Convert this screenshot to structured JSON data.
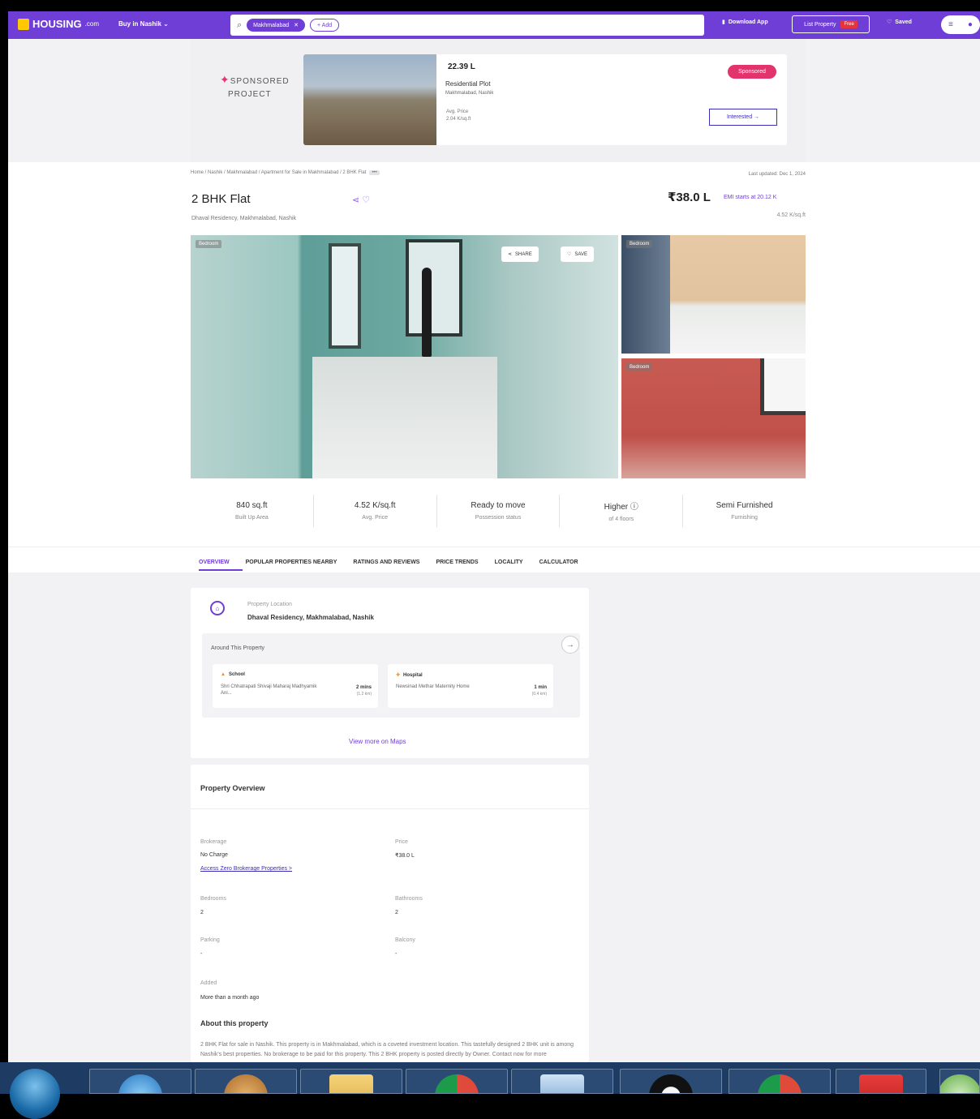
{
  "header": {
    "logo": "HOUSING",
    "logo_suffix": ".com",
    "buy_in": "Buy in Nashik",
    "search_chip": "Makhmalabad",
    "add_chip": "+ Add",
    "download_app": "Download App",
    "list_property": "List Property",
    "free_badge": "Free",
    "saved": "Saved"
  },
  "sponsored": {
    "label_line1": "SPONSORED",
    "label_line2": "PROJECT",
    "price": "22.39 L",
    "type": "Residential Plot",
    "location": "Makhmalabad, Nashik",
    "avg_label": "Avg. Price",
    "avg_value": "2.04 K/sq.ft",
    "badge": "Sponsored",
    "interested": "Interested →"
  },
  "breadcrumb": "Home / Nashik / Makhmalabad / Apartment for Sale in Makhmalabad / 2 BHK Flat",
  "breadcrumb_more": "•••",
  "last_updated": "Last updated: Dec 1, 2024",
  "listing": {
    "title": "2 BHK Flat",
    "subtitle": "Dhaval Residency, Makhmalabad, Nashik",
    "price": "₹38.0 L",
    "emi": "EMI starts at 20.12 K",
    "per_sqft": "4.52 K/sq.ft"
  },
  "gallery": {
    "tag_main": "Bedroom",
    "tag_side1": "Bedroom",
    "tag_side2": "Bedroom",
    "share": "SHARE",
    "save": "SAVE"
  },
  "stats": [
    {
      "value": "840 sq.ft",
      "label": "Built Up Area"
    },
    {
      "value": "4.52 K/sq.ft",
      "label": "Avg. Price"
    },
    {
      "value": "Ready to move",
      "label": "Possession status"
    },
    {
      "value": "Higher",
      "label": "of 4 floors"
    },
    {
      "value": "Semi Furnished",
      "label": "Furnishing"
    }
  ],
  "tabs": [
    "OVERVIEW",
    "POPULAR PROPERTIES NEARBY",
    "RATINGS AND REVIEWS",
    "PRICE TRENDS",
    "LOCALITY",
    "CALCULATOR"
  ],
  "location": {
    "label": "Property Location",
    "value": "Dhaval Residency, Makhmalabad, Nashik",
    "around_label": "Around This Property",
    "amenities": [
      {
        "type": "School",
        "name": "Shri Chhatrapati Shivaji Maharaj Madhyamik Ani...",
        "time": "2 mins",
        "dist": "(1.2 km)"
      },
      {
        "type": "Hospital",
        "name": "Newsinad Methar Maternity Home",
        "time": "1 min",
        "dist": "(0.4 km)"
      }
    ],
    "view_maps": "View more on Maps"
  },
  "overview": {
    "title": "Property Overview",
    "brokerage_label": "Brokerage",
    "brokerage_value": "No Charge",
    "zero_link": "Access Zero Brokerage Properties >",
    "price_label": "Price",
    "price_value": "₹38.0 L",
    "bedrooms_label": "Bedrooms",
    "bedrooms_value": "2",
    "bathrooms_label": "Bathrooms",
    "bathrooms_value": "2",
    "parking_label": "Parking",
    "parking_value": "-",
    "balcony_label": "Balcony",
    "balcony_value": "-",
    "added_label": "Added",
    "added_value": "More than a month ago",
    "about_title": "About this property",
    "about_text": "2 BHK Flat for sale in Nashik. This property is in Makhmalabad, which is a coveted investment location. This tastefully designed 2 BHK unit is among Nashik's best properties. No brokerage to be paid for this property. This 2 BHK property is posted directly by Owner. Contact now for more"
  },
  "colors": {
    "brand_purple": "#6f3ed6",
    "sponsored_pink": "#e3336c",
    "taskbar": "#1e3b63"
  }
}
